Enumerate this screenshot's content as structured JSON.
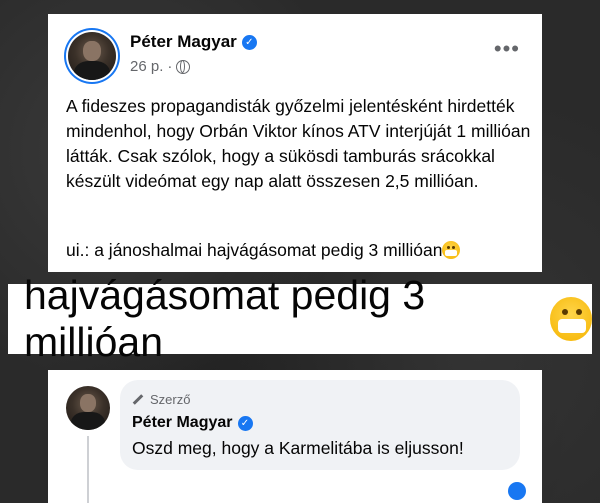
{
  "post": {
    "author": "Péter Magyar",
    "time": "26 p.",
    "separator": "·",
    "more": "•••",
    "paragraph": "A fideszes propagandisták győzelmi jelentésként hirdették mindenhol, hogy Orbán Viktor kínos ATV interjúját 1 millióan látták. Csak szólok, hogy a sükösdi tamburás srácokkal készült videómat egy nap alatt összesen 2,5 millióan.",
    "ps": "ui.: a jánoshalmai hajvágásomat pedig 3 millióan"
  },
  "zoom": {
    "text": "hajvágásomat pedig 3 millióan"
  },
  "comment": {
    "badge": "Szerző",
    "author": "Péter Magyar",
    "text": "Oszd meg, hogy a Karmelitába is eljusson!"
  },
  "icons": {
    "verified": "✓",
    "emoji": "face-with-medical-mask"
  },
  "colors": {
    "facebook_blue": "#1877f2",
    "bubble_bg": "#f0f2f5",
    "secondary_text": "#65676b"
  }
}
